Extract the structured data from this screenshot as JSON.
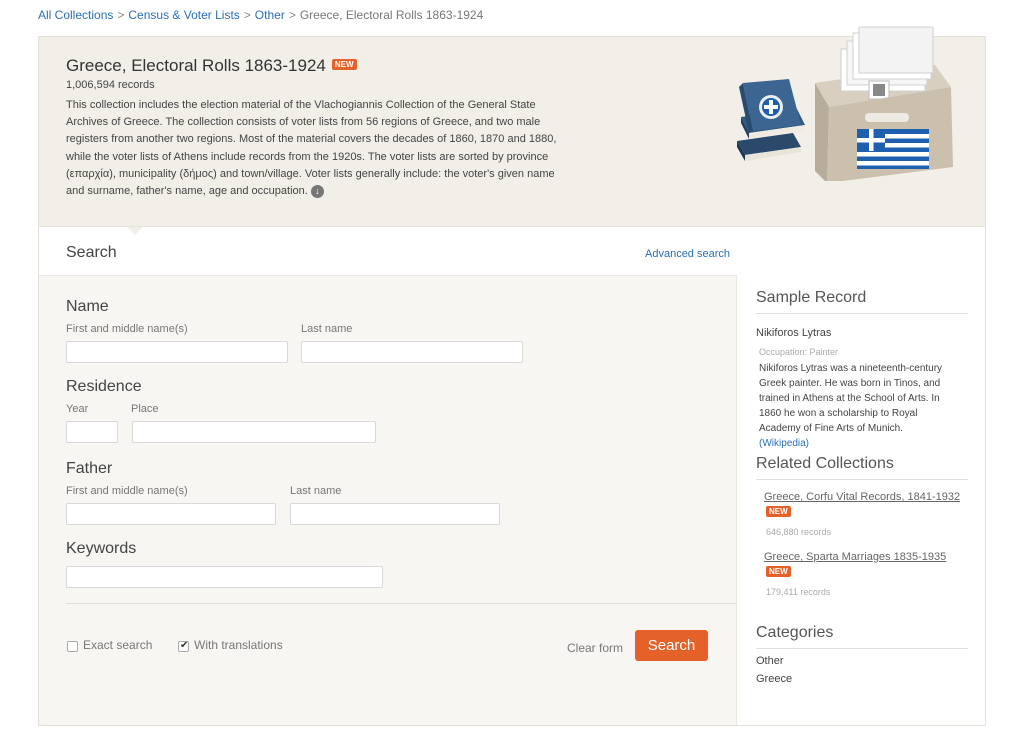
{
  "breadcrumb": {
    "items": [
      "All Collections",
      "Census & Voter Lists",
      "Other"
    ],
    "current": "Greece, Electoral Rolls 1863-1924",
    "separator": ">"
  },
  "hero": {
    "title": "Greece, Electoral Rolls 1863-1924",
    "badge": "NEW",
    "record_count": "1,006,594 records",
    "description": "This collection includes the election material of the Vlachogiannis Collection of the General State Archives of Greece. The collection consists of voter lists from 56 regions of Greece, and two male registers from another two regions. Most of the material covers the decades of 1860, 1870 and 1880, while the voter lists of Athens include records from the 1920s. The voter lists are sorted by province (επαρχία), municipality (δήμος) and town/village. Voter lists generally include: the voter's given name and surname, father's name, age and occupation.",
    "more_icon": "down-arrow-circle-icon"
  },
  "search": {
    "title": "Search",
    "advanced_link": "Advanced search",
    "sections": {
      "name": {
        "heading": "Name",
        "first_label": "First and middle name(s)",
        "last_label": "Last name",
        "first_value": "",
        "last_value": ""
      },
      "residence": {
        "heading": "Residence",
        "year_label": "Year",
        "place_label": "Place",
        "year_value": "",
        "place_value": ""
      },
      "father": {
        "heading": "Father",
        "first_label": "First and middle name(s)",
        "last_label": "Last name",
        "first_value": "",
        "last_value": ""
      },
      "keywords": {
        "heading": "Keywords",
        "value": ""
      }
    },
    "options": {
      "exact_label": "Exact search",
      "exact_checked": false,
      "translations_label": "With translations",
      "translations_checked": true
    },
    "clear_label": "Clear form",
    "submit_label": "Search"
  },
  "sidebar": {
    "sample": {
      "heading": "Sample Record",
      "name": "Nikiforos Lytras",
      "occupation": "Occupation: Painter",
      "description": "Nikiforos Lytras was a nineteenth-century Greek painter. He was born in Tinos, and trained in Athens at the School of Arts. In 1860 he won a scholarship to Royal Academy of Fine Arts of Munich.",
      "link": "(Wikipedia)"
    },
    "related": {
      "heading": "Related Collections",
      "items": [
        {
          "title": "Greece, Corfu Vital Records, 1841-1932",
          "badge": "NEW",
          "count": "646,880 records"
        },
        {
          "title": "Greece, Sparta Marriages 1835-1935",
          "badge": "NEW",
          "count": "179,411 records"
        }
      ]
    },
    "categories": {
      "heading": "Categories",
      "items": [
        "Other",
        "Greece"
      ]
    }
  },
  "colors": {
    "accent": "#e5612a",
    "link": "#2a6fb5",
    "hero_bg": "#f2efe9",
    "panel_bg": "#f7f6f2",
    "greek_blue": "#1f5fb0"
  }
}
